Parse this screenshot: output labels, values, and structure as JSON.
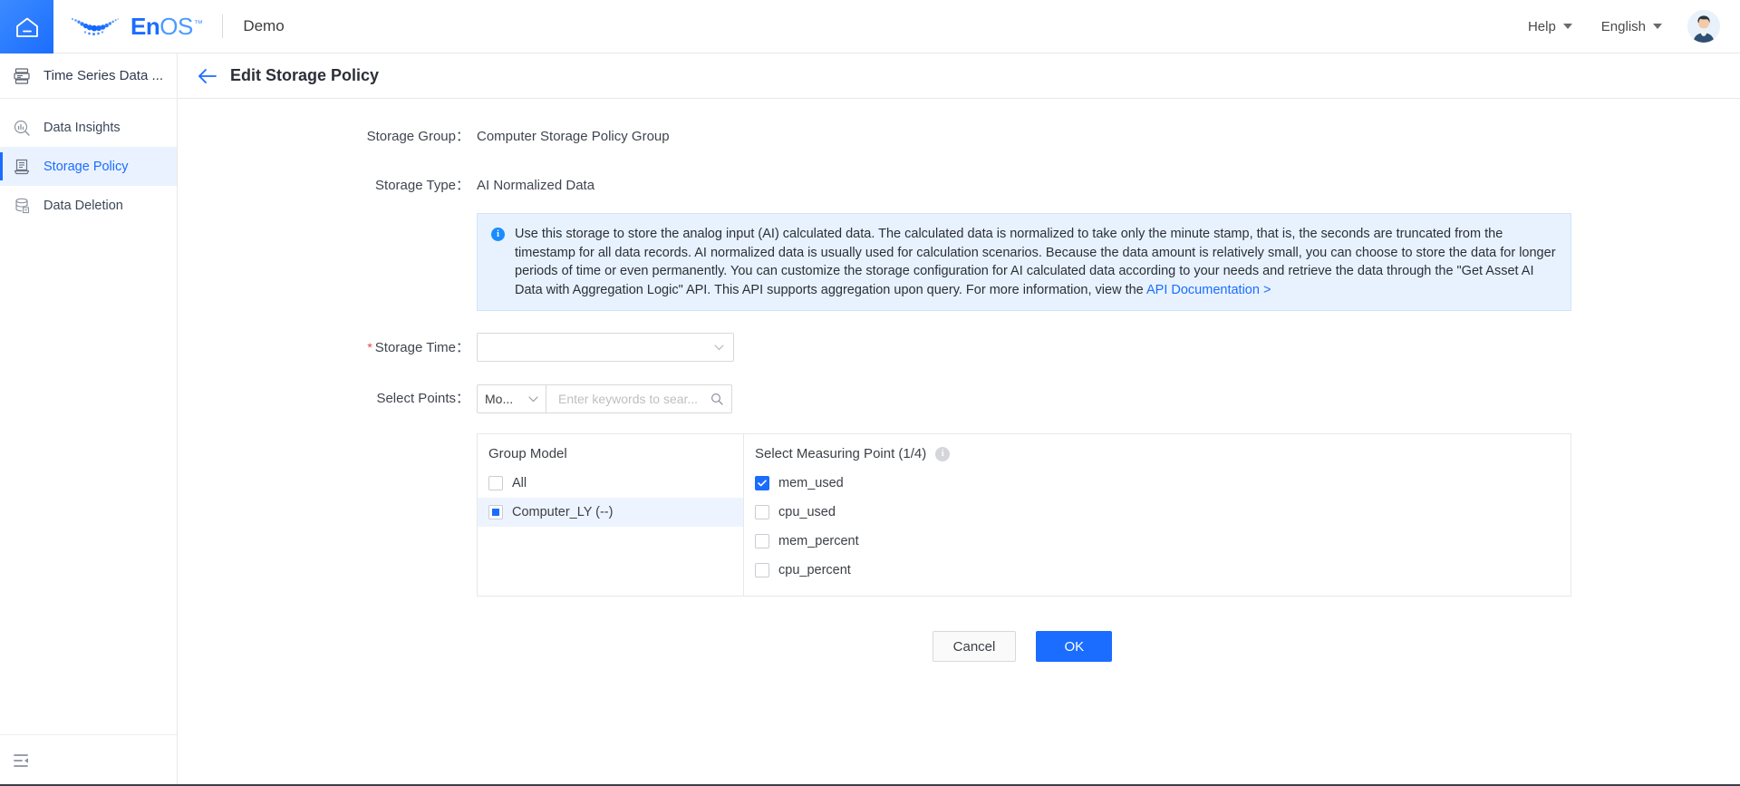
{
  "topbar": {
    "home_icon": "home-icon",
    "logo_en": "En",
    "logo_os": "OS",
    "logo_tm": "™",
    "tenant": "Demo",
    "help_label": "Help",
    "language_label": "English",
    "avatar": "user-avatar"
  },
  "sidebar": {
    "app_title": "Time Series Data ...",
    "items": [
      {
        "label": "Data Insights",
        "icon": "insights-icon",
        "active": false
      },
      {
        "label": "Storage Policy",
        "icon": "storage-policy-icon",
        "active": true
      },
      {
        "label": "Data Deletion",
        "icon": "data-deletion-icon",
        "active": false
      }
    ],
    "collapse_icon": "collapse-sidebar-icon"
  },
  "page": {
    "back_icon": "back-arrow-icon",
    "title": "Edit Storage Policy"
  },
  "form": {
    "storage_group_label": "Storage Group：",
    "storage_group_value": "Computer Storage Policy Group",
    "storage_type_label": "Storage Type：",
    "storage_type_value": "AI Normalized Data",
    "storage_time_label": "Storage Time：",
    "storage_time_required": "*",
    "storage_time_value": "",
    "storage_time_placeholder": "",
    "select_points_label": "Select Points：",
    "points_mode_value": "Mo...",
    "search_value": "",
    "search_placeholder": "Enter keywords to sear..."
  },
  "banner": {
    "icon": "info-icon",
    "text_before_link": "Use this storage to store the analog input (AI) calculated data. The calculated data is normalized to take only the minute stamp, that is, the seconds are truncated from the timestamp for all data records. AI normalized data is usually used for calculation scenarios. Because the data amount is relatively small, you can choose to store the data for longer periods of time or even permanently. You can customize the storage configuration for AI calculated data according to your needs and retrieve the data through the \"Get Asset AI Data with Aggregation Logic\" API. This API supports aggregation upon query. For more information, view the ",
    "link_text": "API Documentation >"
  },
  "group_panel": {
    "title": "Group Model",
    "options": [
      {
        "label": "All",
        "state": "unchecked",
        "selected": false
      },
      {
        "label": "Computer_LY (--)",
        "state": "indeterminate",
        "selected": true
      }
    ]
  },
  "points_panel": {
    "title": "Select Measuring Point (1/4)",
    "info_icon": "info-icon",
    "options": [
      {
        "label": "mem_used",
        "state": "checked"
      },
      {
        "label": "cpu_used",
        "state": "unchecked"
      },
      {
        "label": "mem_percent",
        "state": "unchecked"
      },
      {
        "label": "cpu_percent",
        "state": "unchecked"
      }
    ]
  },
  "actions": {
    "cancel_label": "Cancel",
    "ok_label": "OK"
  },
  "colors": {
    "brand_blue": "#1a6dff",
    "banner_bg": "#e8f2fe",
    "active_item_bg": "#eaf2ff",
    "required_red": "#e8453c"
  }
}
